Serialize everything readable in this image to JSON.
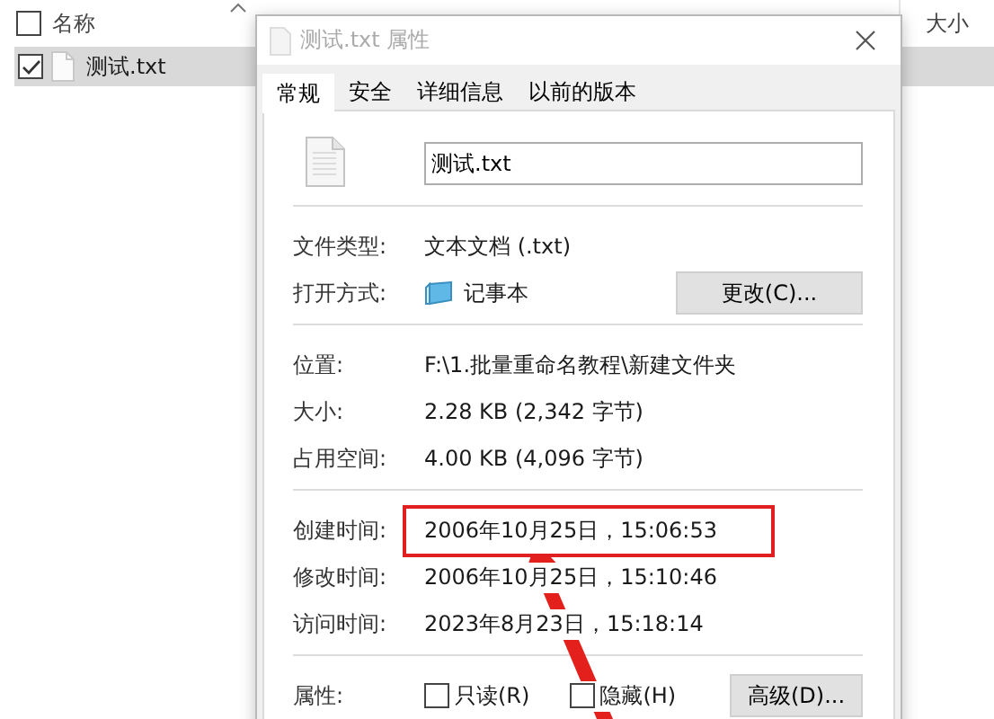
{
  "explorer": {
    "all_checked": false,
    "columns": [
      {
        "label": "名称",
        "sorted": true
      },
      {
        "label": "大小",
        "sorted": false
      }
    ],
    "rows": [
      {
        "name": "测试.txt",
        "checked": true,
        "selected": true
      }
    ]
  },
  "dialog": {
    "title": "测试.txt 属性",
    "active": false,
    "tabs": [
      {
        "label": "常规",
        "selected": true
      },
      {
        "label": "安全",
        "selected": false
      },
      {
        "label": "详细信息",
        "selected": false
      },
      {
        "label": "以前的版本",
        "selected": false
      }
    ],
    "file_name": "测试.txt",
    "sections": [
      [
        {
          "kind": "text",
          "label": "文件类型:",
          "value": "文本文档 (.txt)",
          "highlighted": false
        },
        {
          "kind": "app",
          "label": "打开方式:",
          "value": "记事本",
          "button": "更改(C)..."
        }
      ],
      [
        {
          "kind": "text",
          "label": "位置:",
          "value": "F:\\1.批量重命名教程\\新建文件夹",
          "highlighted": false
        },
        {
          "kind": "text",
          "label": "大小:",
          "value": "2.28 KB (2,342 字节)",
          "highlighted": false
        },
        {
          "kind": "text",
          "label": "占用空间:",
          "value": "4.00 KB (4,096 字节)",
          "highlighted": false
        }
      ],
      [
        {
          "kind": "text",
          "label": "创建时间:",
          "value": "2006年10月25日，15:06:53",
          "highlighted": true
        },
        {
          "kind": "text",
          "label": "修改时间:",
          "value": "2006年10月25日，15:10:46",
          "highlighted": false
        },
        {
          "kind": "text",
          "label": "访问时间:",
          "value": "2023年8月23日，15:18:14",
          "highlighted": false
        }
      ],
      [
        {
          "kind": "attributes",
          "label": "属性:",
          "checkboxes": [
            {
              "label": "只读(R)",
              "checked": false
            },
            {
              "label": "隐藏(H)",
              "checked": false
            }
          ],
          "button": "高级(D)..."
        }
      ]
    ]
  }
}
